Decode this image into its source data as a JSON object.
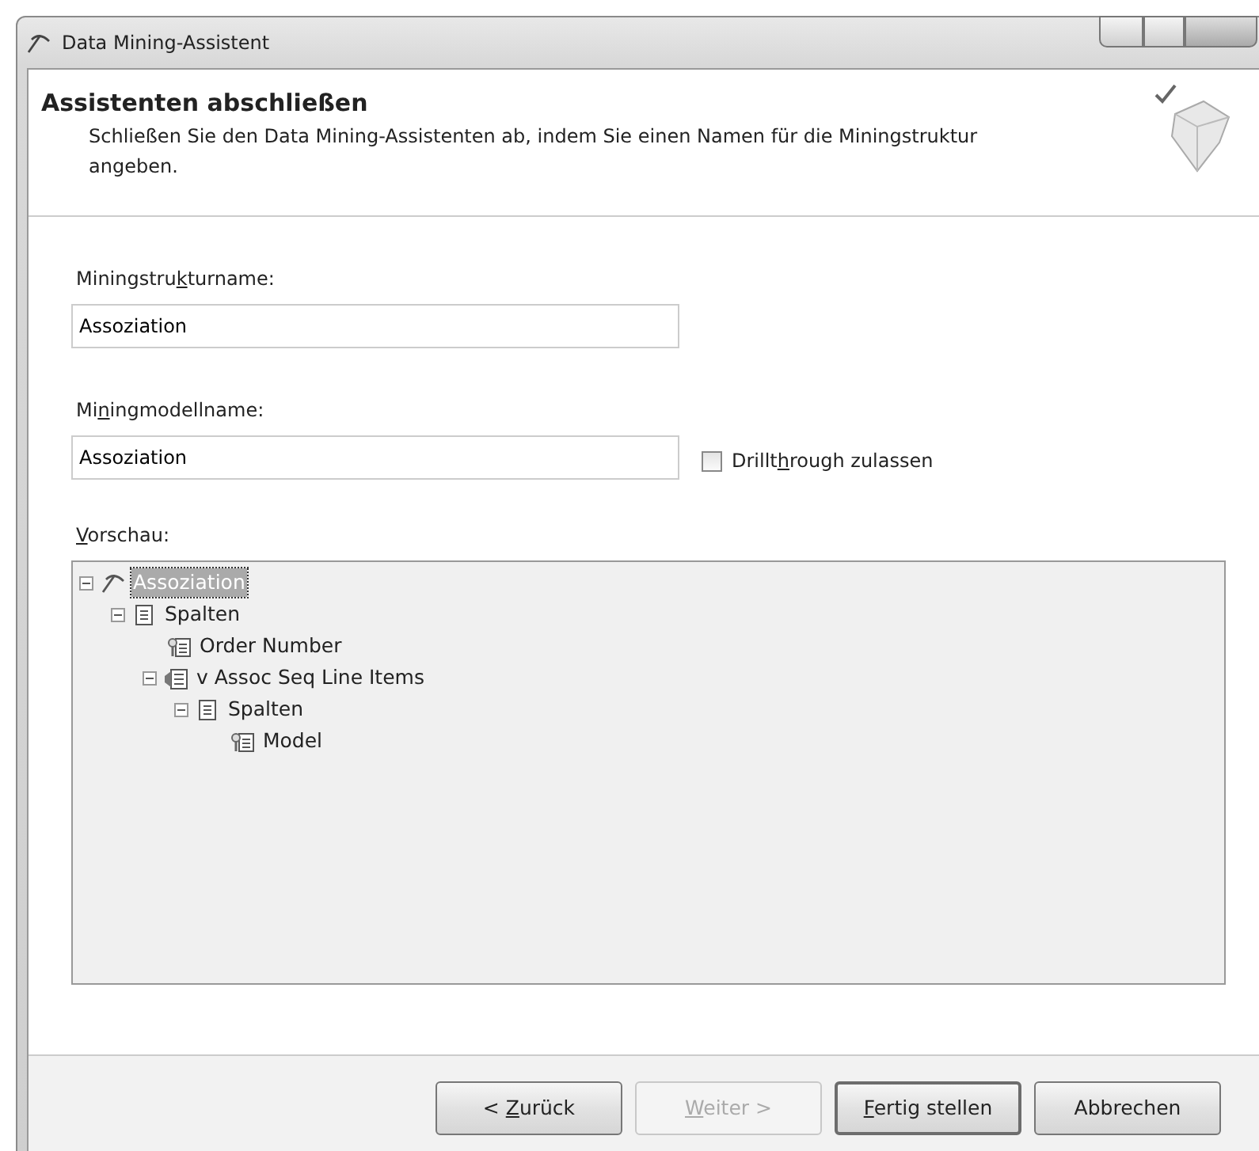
{
  "window": {
    "title": "Data Mining-Assistent"
  },
  "header": {
    "title": "Assistenten abschließen",
    "description": "Schließen Sie den Data Mining-Assistenten ab, indem Sie einen Namen für die Miningstruktur angeben."
  },
  "fields": [
    {
      "label_start": "Miningstru",
      "access_key": "k",
      "label_end": "turname:",
      "value": "Assoziation"
    },
    {
      "label_start": "Mi",
      "access_key": "n",
      "label_end": "ingmodellname:",
      "value": "Assoziation"
    }
  ],
  "drillthrough": {
    "label_start": "Drillt",
    "access_key": "h",
    "label_end": "rough zulassen",
    "checked": false
  },
  "preview": {
    "access_key": "V",
    "label_end": "orschau:",
    "tree": [
      {
        "label": "Assoziation",
        "kind": "structure",
        "expanded": true,
        "selected": true,
        "children": [
          {
            "label": "Spalten",
            "kind": "columns",
            "expanded": true,
            "selected": false,
            "children": [
              {
                "label": "Order Number",
                "kind": "key",
                "selected": false
              },
              {
                "label": "v Assoc Seq Line Items",
                "kind": "table",
                "expanded": true,
                "selected": false,
                "children": [
                  {
                    "label": "Spalten",
                    "kind": "columns",
                    "expanded": true,
                    "selected": false,
                    "children": [
                      {
                        "label": "Model",
                        "kind": "key",
                        "selected": false
                      }
                    ]
                  }
                ]
              }
            ]
          }
        ]
      }
    ]
  },
  "buttons": [
    {
      "label_start": "< ",
      "access_key": "Z",
      "label_end": "urück",
      "disabled": false,
      "default": false
    },
    {
      "access_key": "W",
      "label_end": "eiter >",
      "disabled": true,
      "default": false
    },
    {
      "access_key": "F",
      "label_end": "ertig stellen",
      "disabled": false,
      "default": true
    },
    {
      "label_start": "Abbrechen",
      "disabled": false,
      "default": false
    }
  ]
}
